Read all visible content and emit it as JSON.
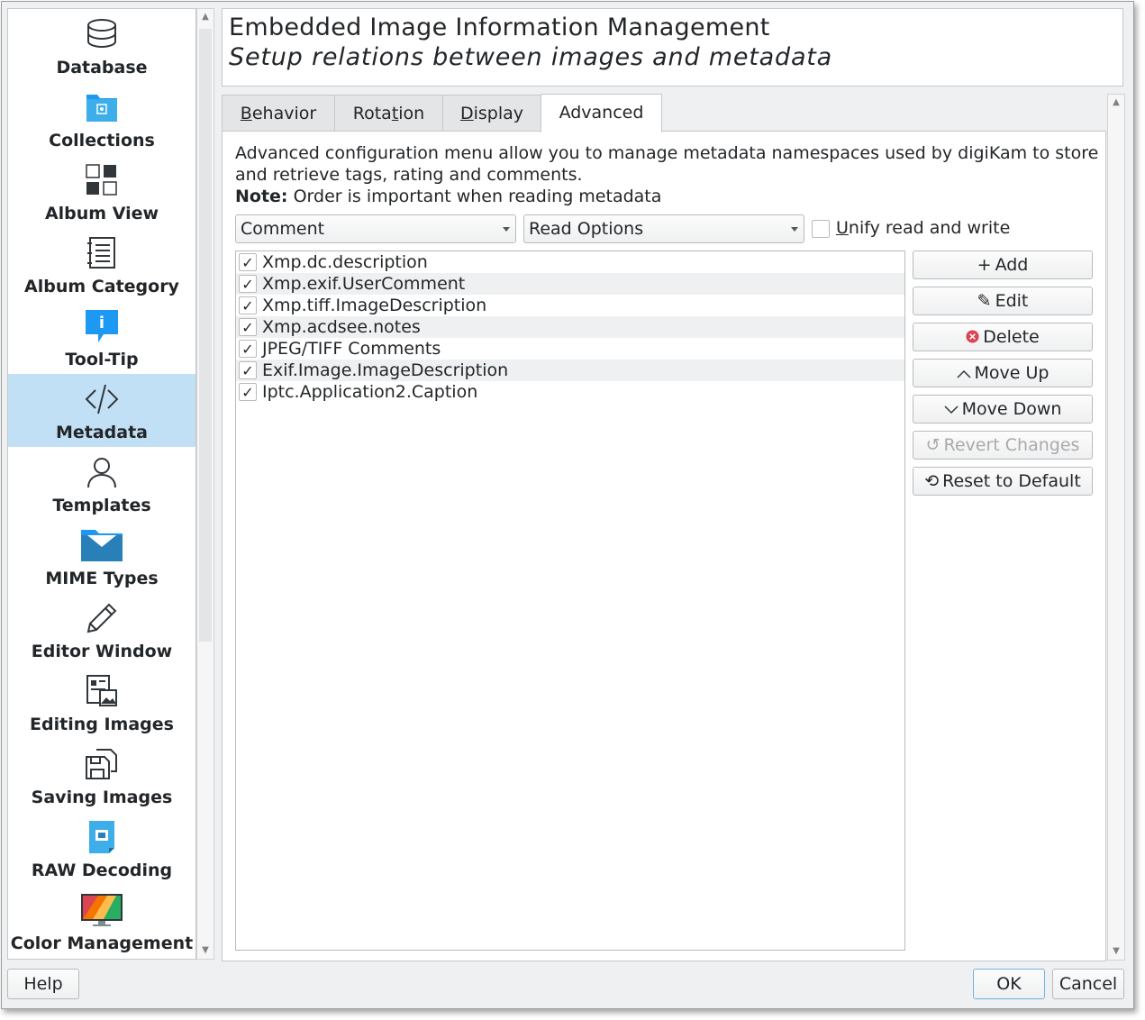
{
  "sidebar": {
    "items": [
      {
        "label": "Database",
        "icon": "database-icon"
      },
      {
        "label": "Collections",
        "icon": "folder-image-icon"
      },
      {
        "label": "Album View",
        "icon": "grid-view-icon"
      },
      {
        "label": "Album Category",
        "icon": "notebook-icon"
      },
      {
        "label": "Tool-Tip",
        "icon": "info-bubble-icon"
      },
      {
        "label": "Metadata",
        "icon": "code-icon",
        "selected": true
      },
      {
        "label": "Templates",
        "icon": "user-icon"
      },
      {
        "label": "MIME Types",
        "icon": "mail-folder-icon"
      },
      {
        "label": "Editor Window",
        "icon": "pencil-icon"
      },
      {
        "label": "Editing Images",
        "icon": "document-image-icon"
      },
      {
        "label": "Saving Images",
        "icon": "save-images-icon"
      },
      {
        "label": "RAW Decoding",
        "icon": "raw-file-icon"
      },
      {
        "label": "Color Management",
        "icon": "monitor-color-icon"
      }
    ]
  },
  "header": {
    "title": "Embedded Image Information Management",
    "subtitle": "Setup relations between images and metadata"
  },
  "tabs": [
    {
      "label": "Behavior",
      "mnemonic": "B",
      "rest": "ehavior"
    },
    {
      "label": "Rotation",
      "pre": "Rota",
      "mnemonic": "t",
      "rest": "ion"
    },
    {
      "label": "Display",
      "mnemonic": "D",
      "rest": "isplay"
    },
    {
      "label": "Advanced",
      "active": true
    }
  ],
  "advanced": {
    "description": "Advanced configuration menu allow you to manage metadata namespaces used by digiKam to store and retrieve tags, rating and comments.",
    "note_label": "Note:",
    "note_text": " Order is important when reading metadata",
    "type_combo": "Comment",
    "options_combo": "Read Options",
    "unify_label": "Unify read and write",
    "unify_checked": false,
    "namespaces": [
      {
        "name": "Xmp.dc.description",
        "checked": true
      },
      {
        "name": "Xmp.exif.UserComment",
        "checked": true
      },
      {
        "name": "Xmp.tiff.ImageDescription",
        "checked": true
      },
      {
        "name": "Xmp.acdsee.notes",
        "checked": true
      },
      {
        "name": "JPEG/TIFF Comments",
        "checked": true
      },
      {
        "name": "Exif.Image.ImageDescription",
        "checked": true
      },
      {
        "name": "Iptc.Application2.Caption",
        "checked": true
      }
    ],
    "buttons": {
      "add": "Add",
      "edit": "Edit",
      "delete": "Delete",
      "move_up": "Move Up",
      "move_down": "Move Down",
      "revert": "Revert Changes",
      "reset": "Reset to Default"
    }
  },
  "footer": {
    "help": "Help",
    "ok": "OK",
    "cancel": "Cancel"
  },
  "colors": {
    "selection": "#c2e0f5",
    "delete_red": "#da4453"
  }
}
